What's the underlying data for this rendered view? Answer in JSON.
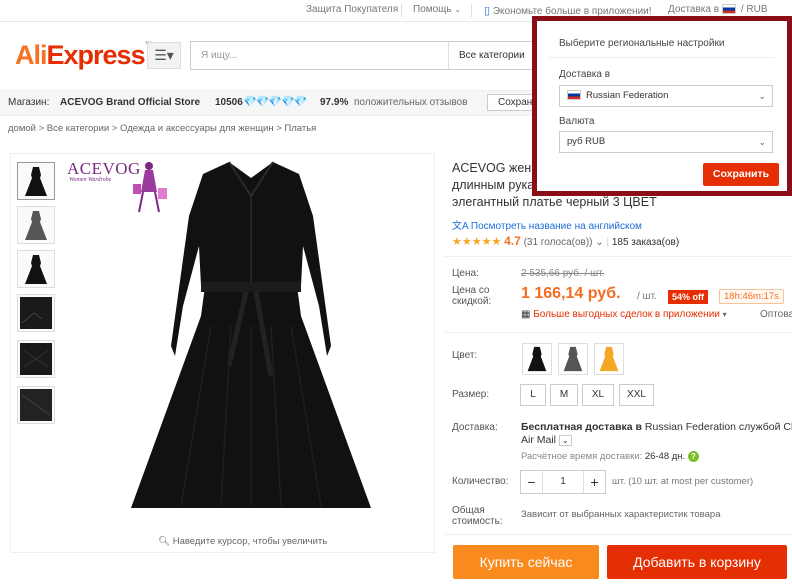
{
  "topbar": {
    "buyer_protection": "Защита Покупателя",
    "help": "Помощь",
    "app_promo": "Экономьте больше в приложении!",
    "ship_to": "Доставка в",
    "currency": "/ RUB"
  },
  "header": {
    "logo": "AliExpress",
    "search_placeholder": "Я ищу...",
    "search_category": "Все категории"
  },
  "store": {
    "label": "Магазин:",
    "name": "ACEVOG Brand Official Store",
    "score": "10506",
    "rating_percent": "97.9%",
    "rating_text": "положительных отзывов",
    "save_button": "Сохран"
  },
  "breadcrumb": [
    "домой",
    "Все категории",
    "Одежда и аксессуары для женщин",
    "Платья"
  ],
  "gallery": {
    "brand": "ACEVOG",
    "brand_sub": "Women Wardrobe",
    "zoom_hint": "Наведите курсор, чтобы увеличить"
  },
  "product": {
    "title_lines": [
      "ACEVOG женщи",
      "длинным рукав",
      "элегантный платье черный 3 ЦВЕТ"
    ],
    "translate_link": "Посмотреть название на английском",
    "rating": "4.7",
    "votes": "(31 голоса(ов))",
    "orders": "185 заказа(ов)",
    "price_label": "Цена:",
    "price_old": "2 535,66 руб. / шт.",
    "discount_label_1": "Цена со",
    "discount_label_2": "скидкой:",
    "price_new": "1 166,14 руб.",
    "unit": "/ шт.",
    "discount": "54% off",
    "timer": "18h:46m:17s",
    "app_deals": "Больше выгодных сделок в приложении",
    "wholesale": "Оптова",
    "color_label": "Цвет:",
    "size_label": "Размер:",
    "sizes": [
      "L",
      "M",
      "XL",
      "XXL"
    ],
    "shipping_label": "Доставка:",
    "shipping_free": "Бесплатная доставка в",
    "shipping_country": "Russian Federation",
    "shipping_service": "службой Ch",
    "shipping_method": "Air Mail",
    "delivery_time_label": "Расчётное время доставки:",
    "delivery_time": "26-48 дн.",
    "qty_label": "Количество:",
    "qty_value": "1",
    "qty_note": "шт. (10 шт. at most per customer)",
    "total_label_1": "Общая",
    "total_label_2": "стоимость:",
    "total_text": "Зависит от выбранных характеристик товара",
    "buy_now": "Купить сейчас",
    "add_to_cart": "Добавить в корзину"
  },
  "popup": {
    "title": "Выберите региональные настройки",
    "ship_label": "Доставка в",
    "ship_value": "Russian Federation",
    "currency_label": "Валюта",
    "currency_value": "руб RUB",
    "save": "Сохранить"
  },
  "colors": {
    "accent_orange": "#f57224",
    "accent_red": "#e62e04",
    "popup_border": "#8b0e17"
  }
}
